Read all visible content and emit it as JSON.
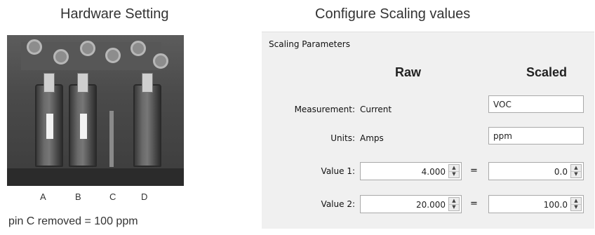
{
  "left": {
    "title": "Hardware Setting",
    "pins": [
      "A",
      "B",
      "C",
      "D"
    ],
    "caption": "pin C removed = 100 ppm"
  },
  "right": {
    "title": "Configure Scaling values",
    "group_label": "Scaling Parameters",
    "col_raw": "Raw",
    "col_scaled": "Scaled",
    "rows": {
      "measurement": {
        "label": "Measurement:",
        "raw": "Current",
        "scaled": "VOC"
      },
      "units": {
        "label": "Units:",
        "raw": "Amps",
        "scaled": "ppm"
      },
      "value1": {
        "label": "Value 1:",
        "raw": "4.000",
        "eq": "=",
        "scaled": "0.0"
      },
      "value2": {
        "label": "Value 2:",
        "raw": "20.000",
        "eq": "=",
        "scaled": "100.0"
      }
    }
  },
  "icons": {
    "spin_up": "spin-up-arrow-icon",
    "spin_down": "spin-down-arrow-icon"
  }
}
